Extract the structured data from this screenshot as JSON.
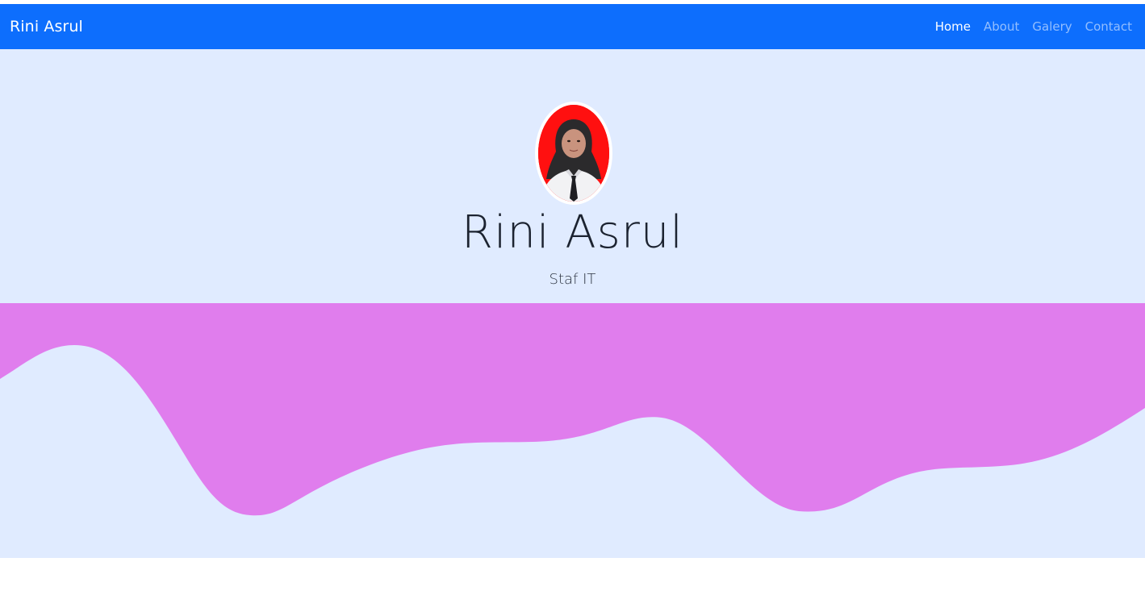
{
  "navbar": {
    "brand": "Rini Asrul",
    "links": [
      {
        "label": "Home",
        "active": true
      },
      {
        "label": "About",
        "active": false
      },
      {
        "label": "Galery",
        "active": false
      },
      {
        "label": "Contact",
        "active": false
      }
    ],
    "background": "#0d6efd"
  },
  "hero": {
    "name": "Rini Asrul",
    "role": "Staf IT",
    "background": "#e0ebff",
    "avatar_background": "#ff1010"
  },
  "wave": {
    "color": "#e07ded"
  }
}
